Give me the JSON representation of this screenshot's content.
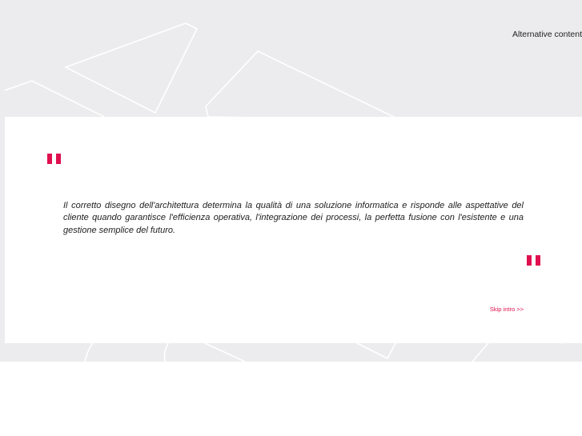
{
  "header": {
    "alternative_content_label": "Alternative content"
  },
  "intro": {
    "quote_text": "Il corretto disegno dell'architettura determina la qualità di una soluzione informatica e risponde alle aspettative del cliente quando garantisce l'efficienza operativa, l'integrazione dei processi, la perfetta fusione con l'esistente e una gestione semplice del futuro.",
    "skip_label": "Skip intro >>"
  },
  "colors": {
    "accent": "#e0104f",
    "background_band": "#ececee",
    "card": "#ffffff",
    "text": "#1e1e1e"
  },
  "icons": {
    "open_quote": "double-bar-quote",
    "close_quote": "double-bar-quote"
  }
}
